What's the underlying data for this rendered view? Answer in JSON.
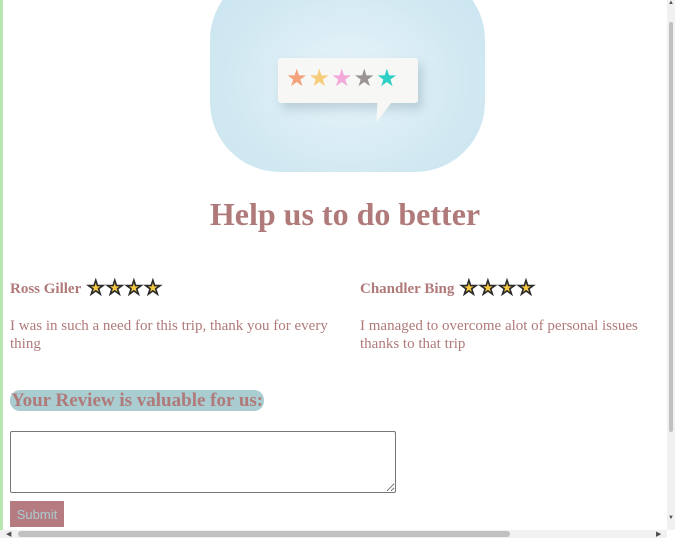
{
  "header": {
    "title": "Help us to do better",
    "hero_image": {
      "stars": [
        {
          "icon": "star-icon",
          "color": "#f4a27c"
        },
        {
          "icon": "star-icon",
          "color": "#f7cd7c"
        },
        {
          "icon": "star-icon",
          "color": "#f2a9d9"
        },
        {
          "icon": "star-icon",
          "color": "#9a9592"
        },
        {
          "icon": "star-icon",
          "color": "#2ecfc4"
        }
      ]
    }
  },
  "reviews": [
    {
      "name": "Ross Giller",
      "rating": 4,
      "text": "I was in such a need for this trip, thank you for every thing"
    },
    {
      "name": "Chandler Bing",
      "rating": 4,
      "text": "I managed to overcome alot of personal issues thanks to that trip"
    }
  ],
  "form": {
    "prompt": "Your Review is valuable for us:",
    "textarea_value": "",
    "submit_label": "Submit"
  },
  "colors": {
    "text": "#b07a7a",
    "prompt_highlight": "#a9cdd1",
    "button_bg": "#b57b80",
    "star_fill": "#f5c842"
  }
}
